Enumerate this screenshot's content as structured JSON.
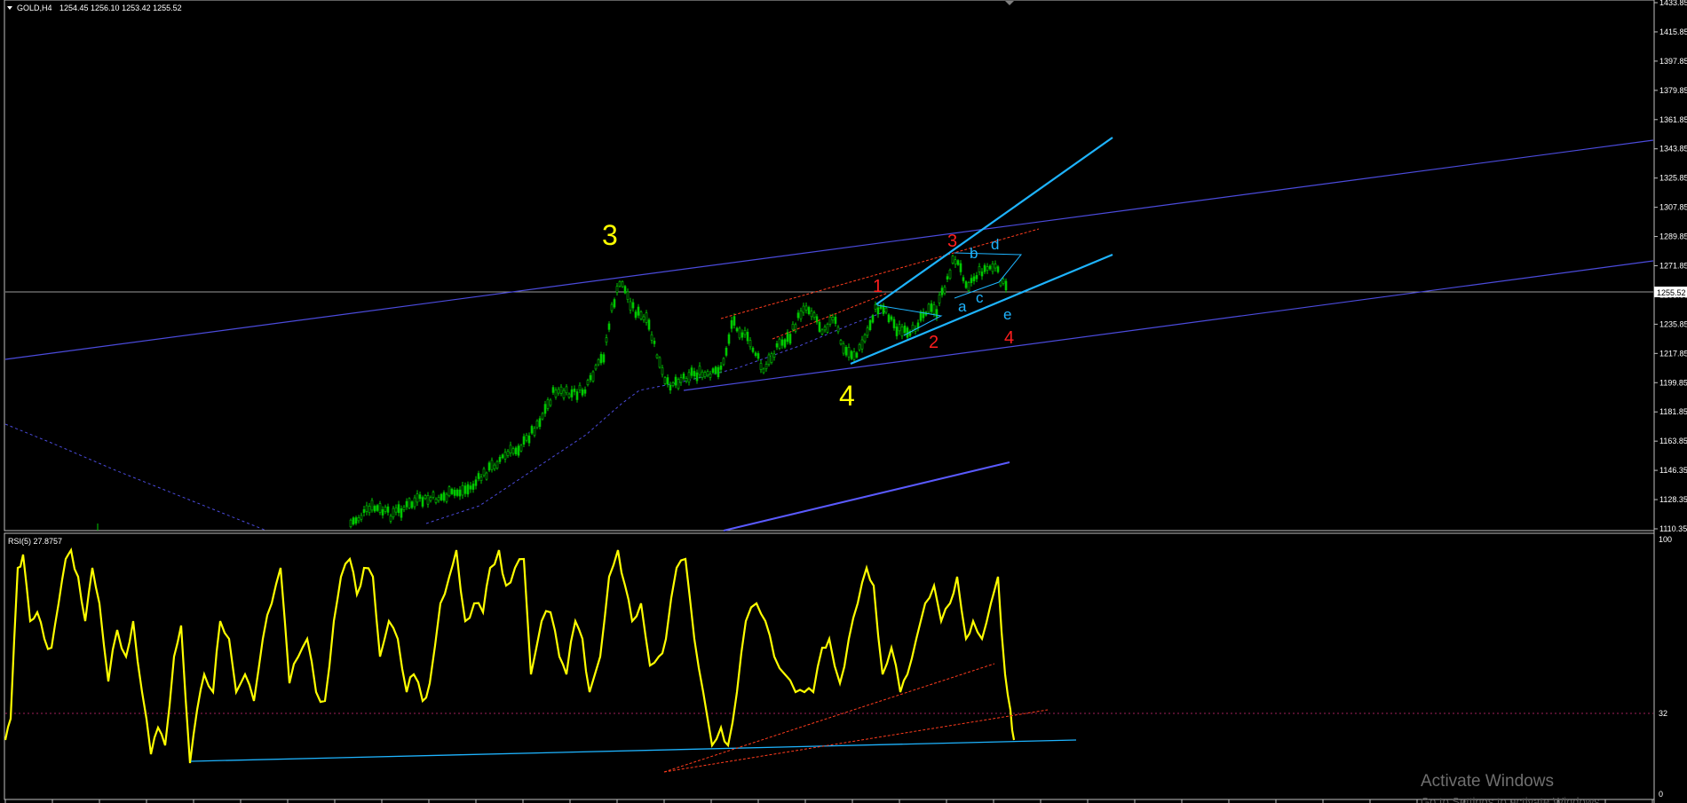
{
  "header": {
    "symbol_label": "GOLD,H4",
    "ohlc_text": "1254.45 1256.10 1253.42 1255.52",
    "dropdown_icon": "triangle-down-icon"
  },
  "price_axis": {
    "labels": [
      "1433.85",
      "1415.85",
      "1397.85",
      "1379.85",
      "1361.85",
      "1343.85",
      "1325.85",
      "1307.85",
      "1289.85",
      "1271.85",
      "1253.85",
      "1235.85",
      "1217.85",
      "1199.85",
      "1181.85",
      "1163.85",
      "1146.35",
      "1128.35",
      "1110.35"
    ],
    "current_price_label": "1255.52",
    "current_price": 1255.52,
    "range": [
      1110.35,
      1433.85
    ]
  },
  "rsi": {
    "label": "RSI(5) 27.8757",
    "axis_labels": [
      "100",
      "32",
      "0"
    ],
    "level": 32,
    "range": [
      0,
      100
    ]
  },
  "wave_labels": {
    "yellow": [
      "3",
      "4"
    ],
    "red": [
      "1",
      "2",
      "3",
      "4"
    ],
    "cyan": [
      "a",
      "b",
      "c",
      "d",
      "e"
    ]
  },
  "watermark": {
    "title": "Activate Windows",
    "subtitle": "Go to Settings to activate Windows."
  },
  "colors": {
    "background": "#000000",
    "candle_up": "#00c800",
    "candle_down": "#00c800",
    "channel_line": "#4b4bdc",
    "wedge_line": "#1eb4ff",
    "rsi_line": "#ffff00",
    "rsi_level": "#a0205a",
    "wave_yellow": "#ffff00",
    "wave_red": "#ff1e1e",
    "wave_cyan": "#1eb4ff",
    "grid_axis": "#c0c0c0"
  }
}
